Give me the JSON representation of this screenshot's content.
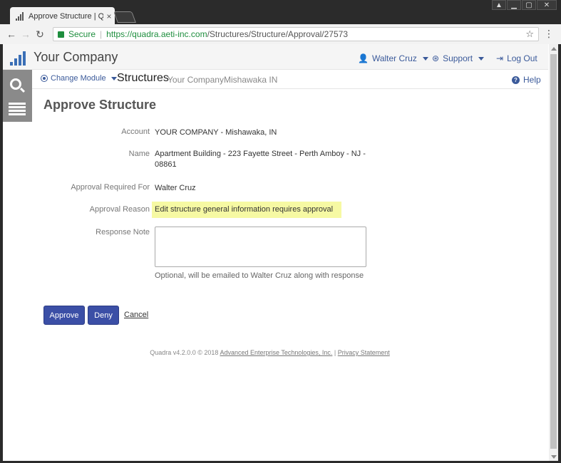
{
  "browser": {
    "tab_title": "Approve Structure | Qua",
    "tab_close": "×",
    "secure_label": "Secure",
    "url_scheme_host": "https://quadra.aeti-inc.com",
    "url_path": "/Structures/Structure/Approval/27573",
    "back_glyph": "←",
    "forward_glyph": "→",
    "reload_glyph": "↻",
    "star_glyph": "☆",
    "menu_glyph": "⋮"
  },
  "header": {
    "company": "Your Company",
    "user": "Walter Cruz",
    "support": "Support",
    "logout": "Log Out"
  },
  "subheader": {
    "change_module": "Change Module",
    "module_title": "Structures",
    "crumb_company": "Your Company",
    "crumb_location": "Mishawaka IN",
    "help": "Help"
  },
  "page": {
    "title": "Approve Structure"
  },
  "form": {
    "account_label": "Account",
    "account_value": "YOUR COMPANY - Mishawaka, IN",
    "name_label": "Name",
    "name_value_line1": "Apartment Building - 223 Fayette Street - Perth Amboy - NJ -",
    "name_value_line2": "08861",
    "approval_required_label": "Approval Required For",
    "approval_required_value": "Walter Cruz",
    "approval_reason_label": "Approval Reason",
    "approval_reason_value": "Edit structure general information requires approval",
    "response_note_label": "Response Note",
    "response_note_value": "",
    "response_note_help": "Optional, will be emailed to Walter Cruz along with response"
  },
  "actions": {
    "approve": "Approve",
    "deny": "Deny",
    "cancel": "Cancel"
  },
  "footer": {
    "prefix": "Quadra v4.2.0.0 © 2018",
    "company_link": "Advanced Enterprise Technologies, Inc.",
    "separator": "|",
    "privacy_link": "Privacy Statement"
  },
  "colors": {
    "accent": "#3b5a9a",
    "button": "#3b4fa6",
    "highlight": "#f6f9a3",
    "secure": "#1e8e3e"
  }
}
